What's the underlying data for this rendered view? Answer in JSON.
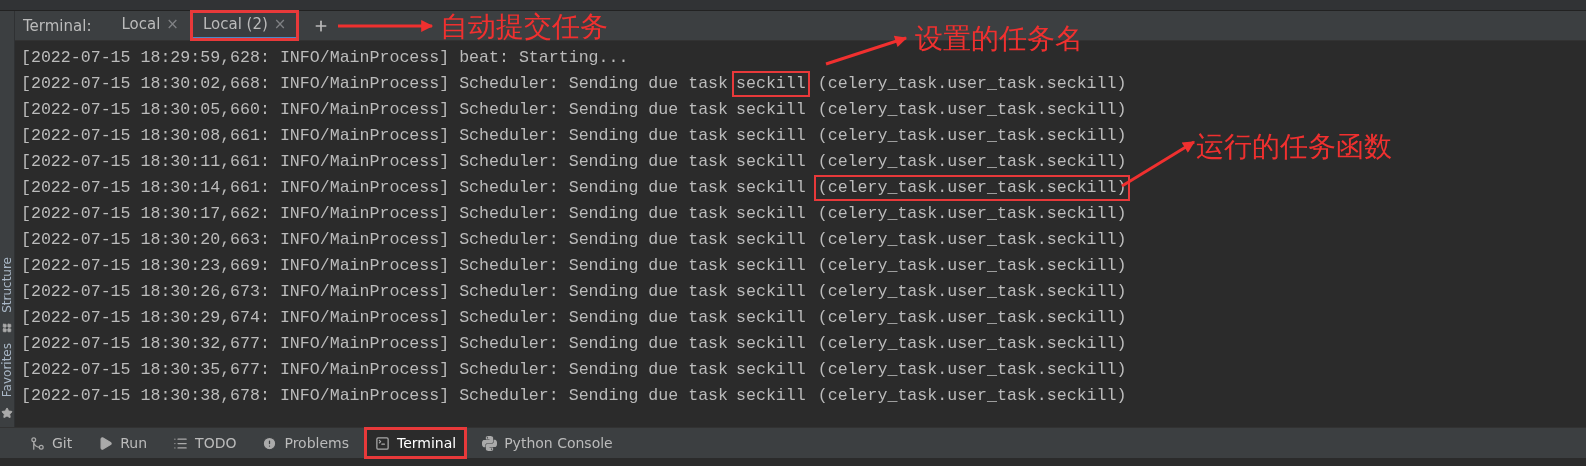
{
  "terminal": {
    "title": "Terminal:",
    "tabs": [
      {
        "label": "Local",
        "close": "×",
        "selected": false,
        "annotated": false
      },
      {
        "label": "Local (2)",
        "close": "×",
        "selected": true,
        "annotated": true
      }
    ],
    "lines": [
      {
        "kind": "plain",
        "text": "[2022-07-15 18:29:59,628: INFO/MainProcess] beat: Starting..."
      },
      {
        "kind": "task",
        "head": "[2022-07-15 18:30:02,668: INFO/MainProcess] Scheduler: Sending due task",
        "task": "seckill",
        "func": "(celery_task.user_task.seckill)",
        "task_boxed": true,
        "func_boxed": false
      },
      {
        "kind": "task",
        "head": "[2022-07-15 18:30:05,660: INFO/MainProcess] Scheduler: Sending due task",
        "task": "seckill",
        "func": "(celery_task.user_task.seckill)",
        "task_boxed": false,
        "func_boxed": false
      },
      {
        "kind": "task",
        "head": "[2022-07-15 18:30:08,661: INFO/MainProcess] Scheduler: Sending due task",
        "task": "seckill",
        "func": "(celery_task.user_task.seckill)",
        "task_boxed": false,
        "func_boxed": false
      },
      {
        "kind": "task",
        "head": "[2022-07-15 18:30:11,661: INFO/MainProcess] Scheduler: Sending due task",
        "task": "seckill",
        "func": "(celery_task.user_task.seckill)",
        "task_boxed": false,
        "func_boxed": false
      },
      {
        "kind": "task",
        "head": "[2022-07-15 18:30:14,661: INFO/MainProcess] Scheduler: Sending due task",
        "task": "seckill",
        "func": "(celery_task.user_task.seckill)",
        "task_boxed": false,
        "func_boxed": true
      },
      {
        "kind": "task",
        "head": "[2022-07-15 18:30:17,662: INFO/MainProcess] Scheduler: Sending due task",
        "task": "seckill",
        "func": "(celery_task.user_task.seckill)",
        "task_boxed": false,
        "func_boxed": false
      },
      {
        "kind": "task",
        "head": "[2022-07-15 18:30:20,663: INFO/MainProcess] Scheduler: Sending due task",
        "task": "seckill",
        "func": "(celery_task.user_task.seckill)",
        "task_boxed": false,
        "func_boxed": false
      },
      {
        "kind": "task",
        "head": "[2022-07-15 18:30:23,669: INFO/MainProcess] Scheduler: Sending due task",
        "task": "seckill",
        "func": "(celery_task.user_task.seckill)",
        "task_boxed": false,
        "func_boxed": false
      },
      {
        "kind": "task",
        "head": "[2022-07-15 18:30:26,673: INFO/MainProcess] Scheduler: Sending due task",
        "task": "seckill",
        "func": "(celery_task.user_task.seckill)",
        "task_boxed": false,
        "func_boxed": false
      },
      {
        "kind": "task",
        "head": "[2022-07-15 18:30:29,674: INFO/MainProcess] Scheduler: Sending due task",
        "task": "seckill",
        "func": "(celery_task.user_task.seckill)",
        "task_boxed": false,
        "func_boxed": false
      },
      {
        "kind": "task",
        "head": "[2022-07-15 18:30:32,677: INFO/MainProcess] Scheduler: Sending due task",
        "task": "seckill",
        "func": "(celery_task.user_task.seckill)",
        "task_boxed": false,
        "func_boxed": false
      },
      {
        "kind": "task",
        "head": "[2022-07-15 18:30:35,677: INFO/MainProcess] Scheduler: Sending due task",
        "task": "seckill",
        "func": "(celery_task.user_task.seckill)",
        "task_boxed": false,
        "func_boxed": false
      },
      {
        "kind": "task",
        "head": "[2022-07-15 18:30:38,678: INFO/MainProcess] Scheduler: Sending due task",
        "task": "seckill",
        "func": "(celery_task.user_task.seckill)",
        "task_boxed": false,
        "func_boxed": false
      }
    ]
  },
  "side_strip": [
    {
      "kind": "structure",
      "label": "Structure"
    },
    {
      "kind": "favorites",
      "label": "Favorites"
    }
  ],
  "tool_bar": [
    {
      "kind": "git",
      "label": "Git",
      "selected": false,
      "annotated": false
    },
    {
      "kind": "run",
      "label": "Run",
      "selected": false,
      "annotated": false
    },
    {
      "kind": "todo",
      "label": "TODO",
      "selected": false,
      "annotated": false
    },
    {
      "kind": "problems",
      "label": "Problems",
      "selected": false,
      "annotated": false
    },
    {
      "kind": "terminal",
      "label": "Terminal",
      "selected": true,
      "annotated": true
    },
    {
      "kind": "python",
      "label": "Python Console",
      "selected": false,
      "annotated": false
    }
  ],
  "annotations": [
    {
      "kind": "tab",
      "text": "自动提交任务"
    },
    {
      "kind": "task",
      "text": "设置的任务名"
    },
    {
      "kind": "func",
      "text": "运行的任务函数"
    }
  ]
}
